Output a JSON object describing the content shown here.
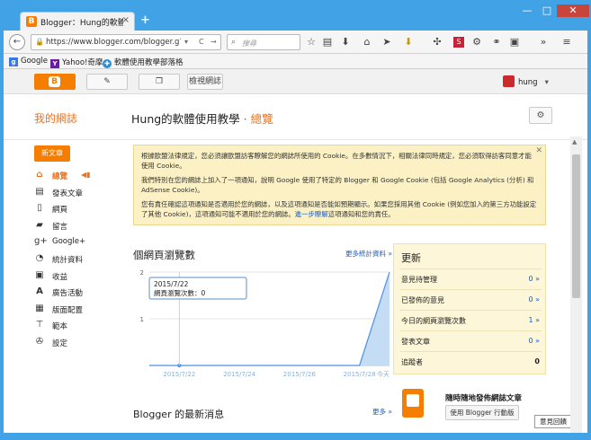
{
  "browser": {
    "tab_title": "Blogger：Hung的軟體使用",
    "tab_close": "×",
    "new_tab": "+",
    "url": "https://www.blogger.com/blogger.g?blogID=26",
    "search_placeholder": "搜尋",
    "window_controls": {
      "minimize": "—",
      "maximize": "□",
      "close": "✕"
    }
  },
  "bookmarks": [
    {
      "label": "Google",
      "icon": "google-icon",
      "color": "#3b78e7"
    },
    {
      "label": "Yahoo!奇摩",
      "icon": "yahoo-icon",
      "color": "#6b1aa3"
    },
    {
      "label": "軟體使用教學部落格",
      "icon": "blogger-icon",
      "color": "#2a8fd8"
    }
  ],
  "appbar": {
    "view_blog_label": "檢視網誌",
    "username": "hung"
  },
  "header": {
    "my_blogs": "我的網誌",
    "blog_title": "Hung的軟體使用教學",
    "separator": "·",
    "section": "總覽"
  },
  "sidebar": {
    "new_post": "新文章",
    "items": [
      {
        "label": "總覽",
        "icon": "home-icon"
      },
      {
        "label": "發表文章",
        "icon": "posts-icon"
      },
      {
        "label": "網頁",
        "icon": "pages-icon"
      },
      {
        "label": "留言",
        "icon": "comments-icon"
      },
      {
        "label": "Google+",
        "icon": "gplus-icon"
      },
      {
        "label": "統計資料",
        "icon": "stats-icon"
      },
      {
        "label": "收益",
        "icon": "earnings-icon"
      },
      {
        "label": "廣告活動",
        "icon": "campaigns-icon"
      },
      {
        "label": "版面配置",
        "icon": "layout-icon"
      },
      {
        "label": "範本",
        "icon": "template-icon"
      },
      {
        "label": "設定",
        "icon": "settings-icon"
      }
    ]
  },
  "cookie_notice": {
    "p1": "根據歐盟法律規定，您必須讓歐盟訪客瞭解您的網誌所使用的 Cookie。在多數情況下，相關法律同時規定，您必須取得訪客同意才能使用 Cookie。",
    "p2": "我們特別在您的網誌上加入了一項通知，說明 Google 使用了特定的 Blogger 和 Google Cookie (包括 Google Analytics (分析) 和 AdSense Cookie)。",
    "p3": "您有責任確認這項通知是否適用於您的網誌，以及這項通知是否能如預期顯示。如果您採用其他 Cookie (例如您加入的第三方功能設定了其他 Cookie)，這項通知可能不適用於您的網誌。",
    "link": "進一步瞭解",
    "p3_tail": "這項通知和您的責任。",
    "close": "✕"
  },
  "pageviews": {
    "title": "個網頁瀏覽數",
    "more_link": "更多統計資料 »",
    "tooltip_date": "2015/7/22",
    "tooltip_label": "網頁瀏覽次數：",
    "tooltip_value": "0"
  },
  "chart_data": {
    "type": "area",
    "x": [
      "2015/7/21",
      "2015/7/22",
      "2015/7/23",
      "2015/7/24",
      "2015/7/25",
      "2015/7/26",
      "2015/7/27",
      "2015/7/28",
      "2015/7/29"
    ],
    "y_tick_labels": [
      "2",
      "1"
    ],
    "x_tick_labels": [
      "2015/7/22",
      "2015/7/24",
      "2015/7/26",
      "2015/7/28",
      "今天"
    ],
    "series": [
      {
        "values": [
          0,
          0,
          0,
          0,
          0,
          0,
          0,
          0,
          2
        ]
      }
    ],
    "ylim": [
      0,
      2
    ],
    "colors": {
      "line": "#4a90e2",
      "fill": "#c5dcf5"
    }
  },
  "updates": {
    "title": "更新",
    "rows": [
      {
        "label": "意見待管理",
        "value": "0 »"
      },
      {
        "label": "已發佈的意見",
        "value": "0 »"
      },
      {
        "label": "今日的網頁瀏覽次數",
        "value": "1 »"
      },
      {
        "label": "發表文章",
        "value": "0 »"
      },
      {
        "label": "追蹤者",
        "value": "0"
      }
    ]
  },
  "promo": {
    "text": "隨時隨地發佈網誌文章",
    "button": "使用 Blogger 行動版"
  },
  "news": {
    "title": "Blogger 的最新消息",
    "more_link": "更多 »"
  },
  "feedback": "意見回饋",
  "colors": {
    "accent": "#f57d00",
    "link": "#1a5dc4",
    "chrome": "#41a3e6"
  }
}
